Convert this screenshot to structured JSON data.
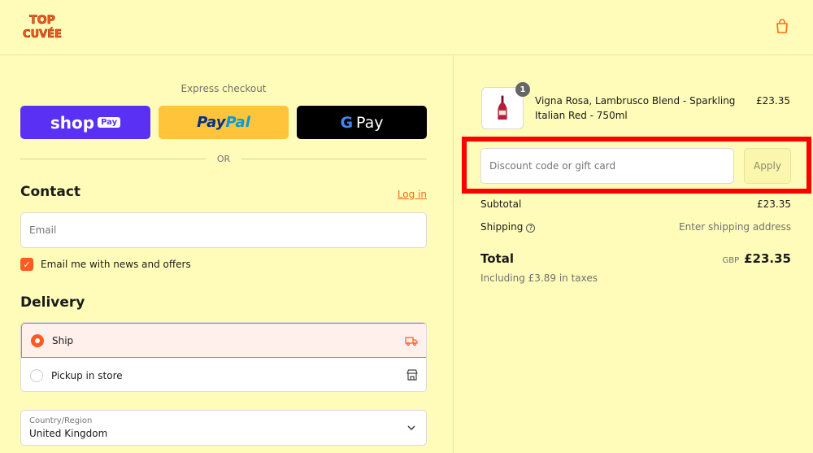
{
  "brand": {
    "logo_line1": "TOP",
    "logo_line2": "CUVÉE",
    "accent": "#ff5a1f",
    "background": "#fffcb9"
  },
  "header": {
    "cart_icon": "shopping-bag-icon"
  },
  "express": {
    "title": "Express checkout",
    "shop_pay": {
      "word": "shop",
      "badge": "Pay"
    },
    "paypal": {
      "part1": "Pay",
      "part2": "Pal"
    },
    "gpay": {
      "g": "G",
      "word": "Pay"
    },
    "or": "OR"
  },
  "contact": {
    "heading": "Contact",
    "login": "Log in",
    "email_placeholder": "Email",
    "newsletter_label": "Email me with news and offers",
    "newsletter_checked": true
  },
  "delivery": {
    "heading": "Delivery",
    "options": [
      {
        "label": "Ship",
        "selected": true,
        "icon": "truck-icon"
      },
      {
        "label": "Pickup in store",
        "selected": false,
        "icon": "store-icon"
      }
    ],
    "country_label": "Country/Region",
    "country_value": "United Kingdom"
  },
  "summary": {
    "item": {
      "quantity": "1",
      "name": "Vigna Rosa, Lambrusco Blend - Sparkling Italian Red - 750ml",
      "price": "£23.35"
    },
    "discount_placeholder": "Discount code or gift card",
    "apply_label": "Apply",
    "subtotal_label": "Subtotal",
    "subtotal_value": "£23.35",
    "shipping_label": "Shipping",
    "shipping_help": "?",
    "shipping_value": "Enter shipping address",
    "total_label": "Total",
    "currency": "GBP",
    "total_value": "£23.35",
    "taxes_note": "Including £3.89 in taxes"
  }
}
